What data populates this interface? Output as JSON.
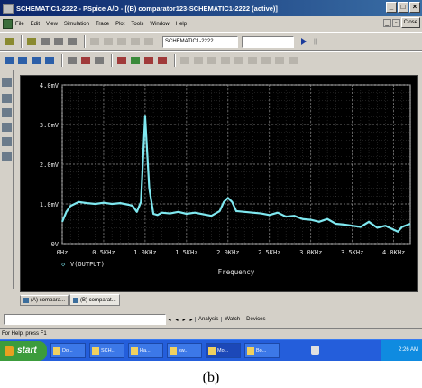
{
  "window": {
    "title": "SCHEMATIC1-2222 - PSpice A/D - [(B) comparator123-SCHEMATIC1-2222 (active)]",
    "buttons": [
      "_",
      "□",
      "×"
    ]
  },
  "menubar": {
    "items": [
      "File",
      "Edit",
      "View",
      "Simulation",
      "Trace",
      "Plot",
      "Tools",
      "Window",
      "Help"
    ],
    "close_label": "Close"
  },
  "toolbar": {
    "profile_value": "SCHEMATIC1-2222",
    "second_value": ""
  },
  "plot": {
    "trace_legend": "V(OUTPUT)",
    "legend_marker": "◇"
  },
  "tabs": [
    "(A) compara...",
    "(B) comparat..."
  ],
  "output_tabs": [
    "Analysis",
    "Watch",
    "Devices"
  ],
  "status": "For Help, press F1",
  "taskbar": {
    "start_label": "start",
    "tasks": [
      "Do...",
      "SCH...",
      "Ha...",
      "sw...",
      "Mo...",
      "Bo..."
    ],
    "clock": "2:26 AM"
  },
  "caption": "(b)",
  "chart_data": {
    "type": "line",
    "title": "",
    "xlabel": "Frequency",
    "ylabel": "",
    "xlim": [
      0,
      4.2
    ],
    "ylim": [
      0,
      4.0
    ],
    "grid": true,
    "x_tick_labels": [
      "0Hz",
      "0.5KHz",
      "1.0KHz",
      "1.5KHz",
      "2.0KHz",
      "2.5KHz",
      "3.0KHz",
      "3.5KHz",
      "4.0KHz"
    ],
    "x_ticks": [
      0,
      0.5,
      1.0,
      1.5,
      2.0,
      2.5,
      3.0,
      3.5,
      4.0
    ],
    "y_tick_labels": [
      "0V",
      "1.0mV",
      "2.0mV",
      "3.0mV",
      "4.0mV"
    ],
    "y_ticks": [
      0,
      1,
      2,
      3,
      4
    ],
    "colors": {
      "trace": "#7fe8f0",
      "grid": "#8a8a8a",
      "background": "#000000"
    },
    "series": [
      {
        "name": "V(OUTPUT)",
        "x": [
          0.0,
          0.05,
          0.1,
          0.15,
          0.2,
          0.3,
          0.4,
          0.5,
          0.6,
          0.7,
          0.8,
          0.85,
          0.9,
          0.95,
          1.0,
          1.05,
          1.1,
          1.15,
          1.2,
          1.3,
          1.4,
          1.5,
          1.6,
          1.7,
          1.8,
          1.9,
          1.95,
          2.0,
          2.05,
          2.1,
          2.2,
          2.3,
          2.4,
          2.5,
          2.6,
          2.7,
          2.8,
          2.9,
          3.0,
          3.1,
          3.2,
          3.3,
          3.4,
          3.5,
          3.6,
          3.7,
          3.8,
          3.9,
          4.0,
          4.05,
          4.1,
          4.2
        ],
        "y": [
          0.55,
          0.8,
          0.95,
          1.0,
          1.05,
          1.02,
          1.0,
          1.03,
          1.0,
          1.02,
          0.98,
          0.95,
          0.8,
          1.05,
          3.2,
          1.4,
          0.75,
          0.72,
          0.78,
          0.76,
          0.8,
          0.75,
          0.78,
          0.74,
          0.7,
          0.82,
          1.05,
          1.15,
          1.05,
          0.82,
          0.8,
          0.78,
          0.76,
          0.72,
          0.78,
          0.68,
          0.7,
          0.62,
          0.6,
          0.55,
          0.62,
          0.5,
          0.48,
          0.45,
          0.42,
          0.55,
          0.4,
          0.45,
          0.35,
          0.3,
          0.42,
          0.5
        ]
      }
    ]
  }
}
